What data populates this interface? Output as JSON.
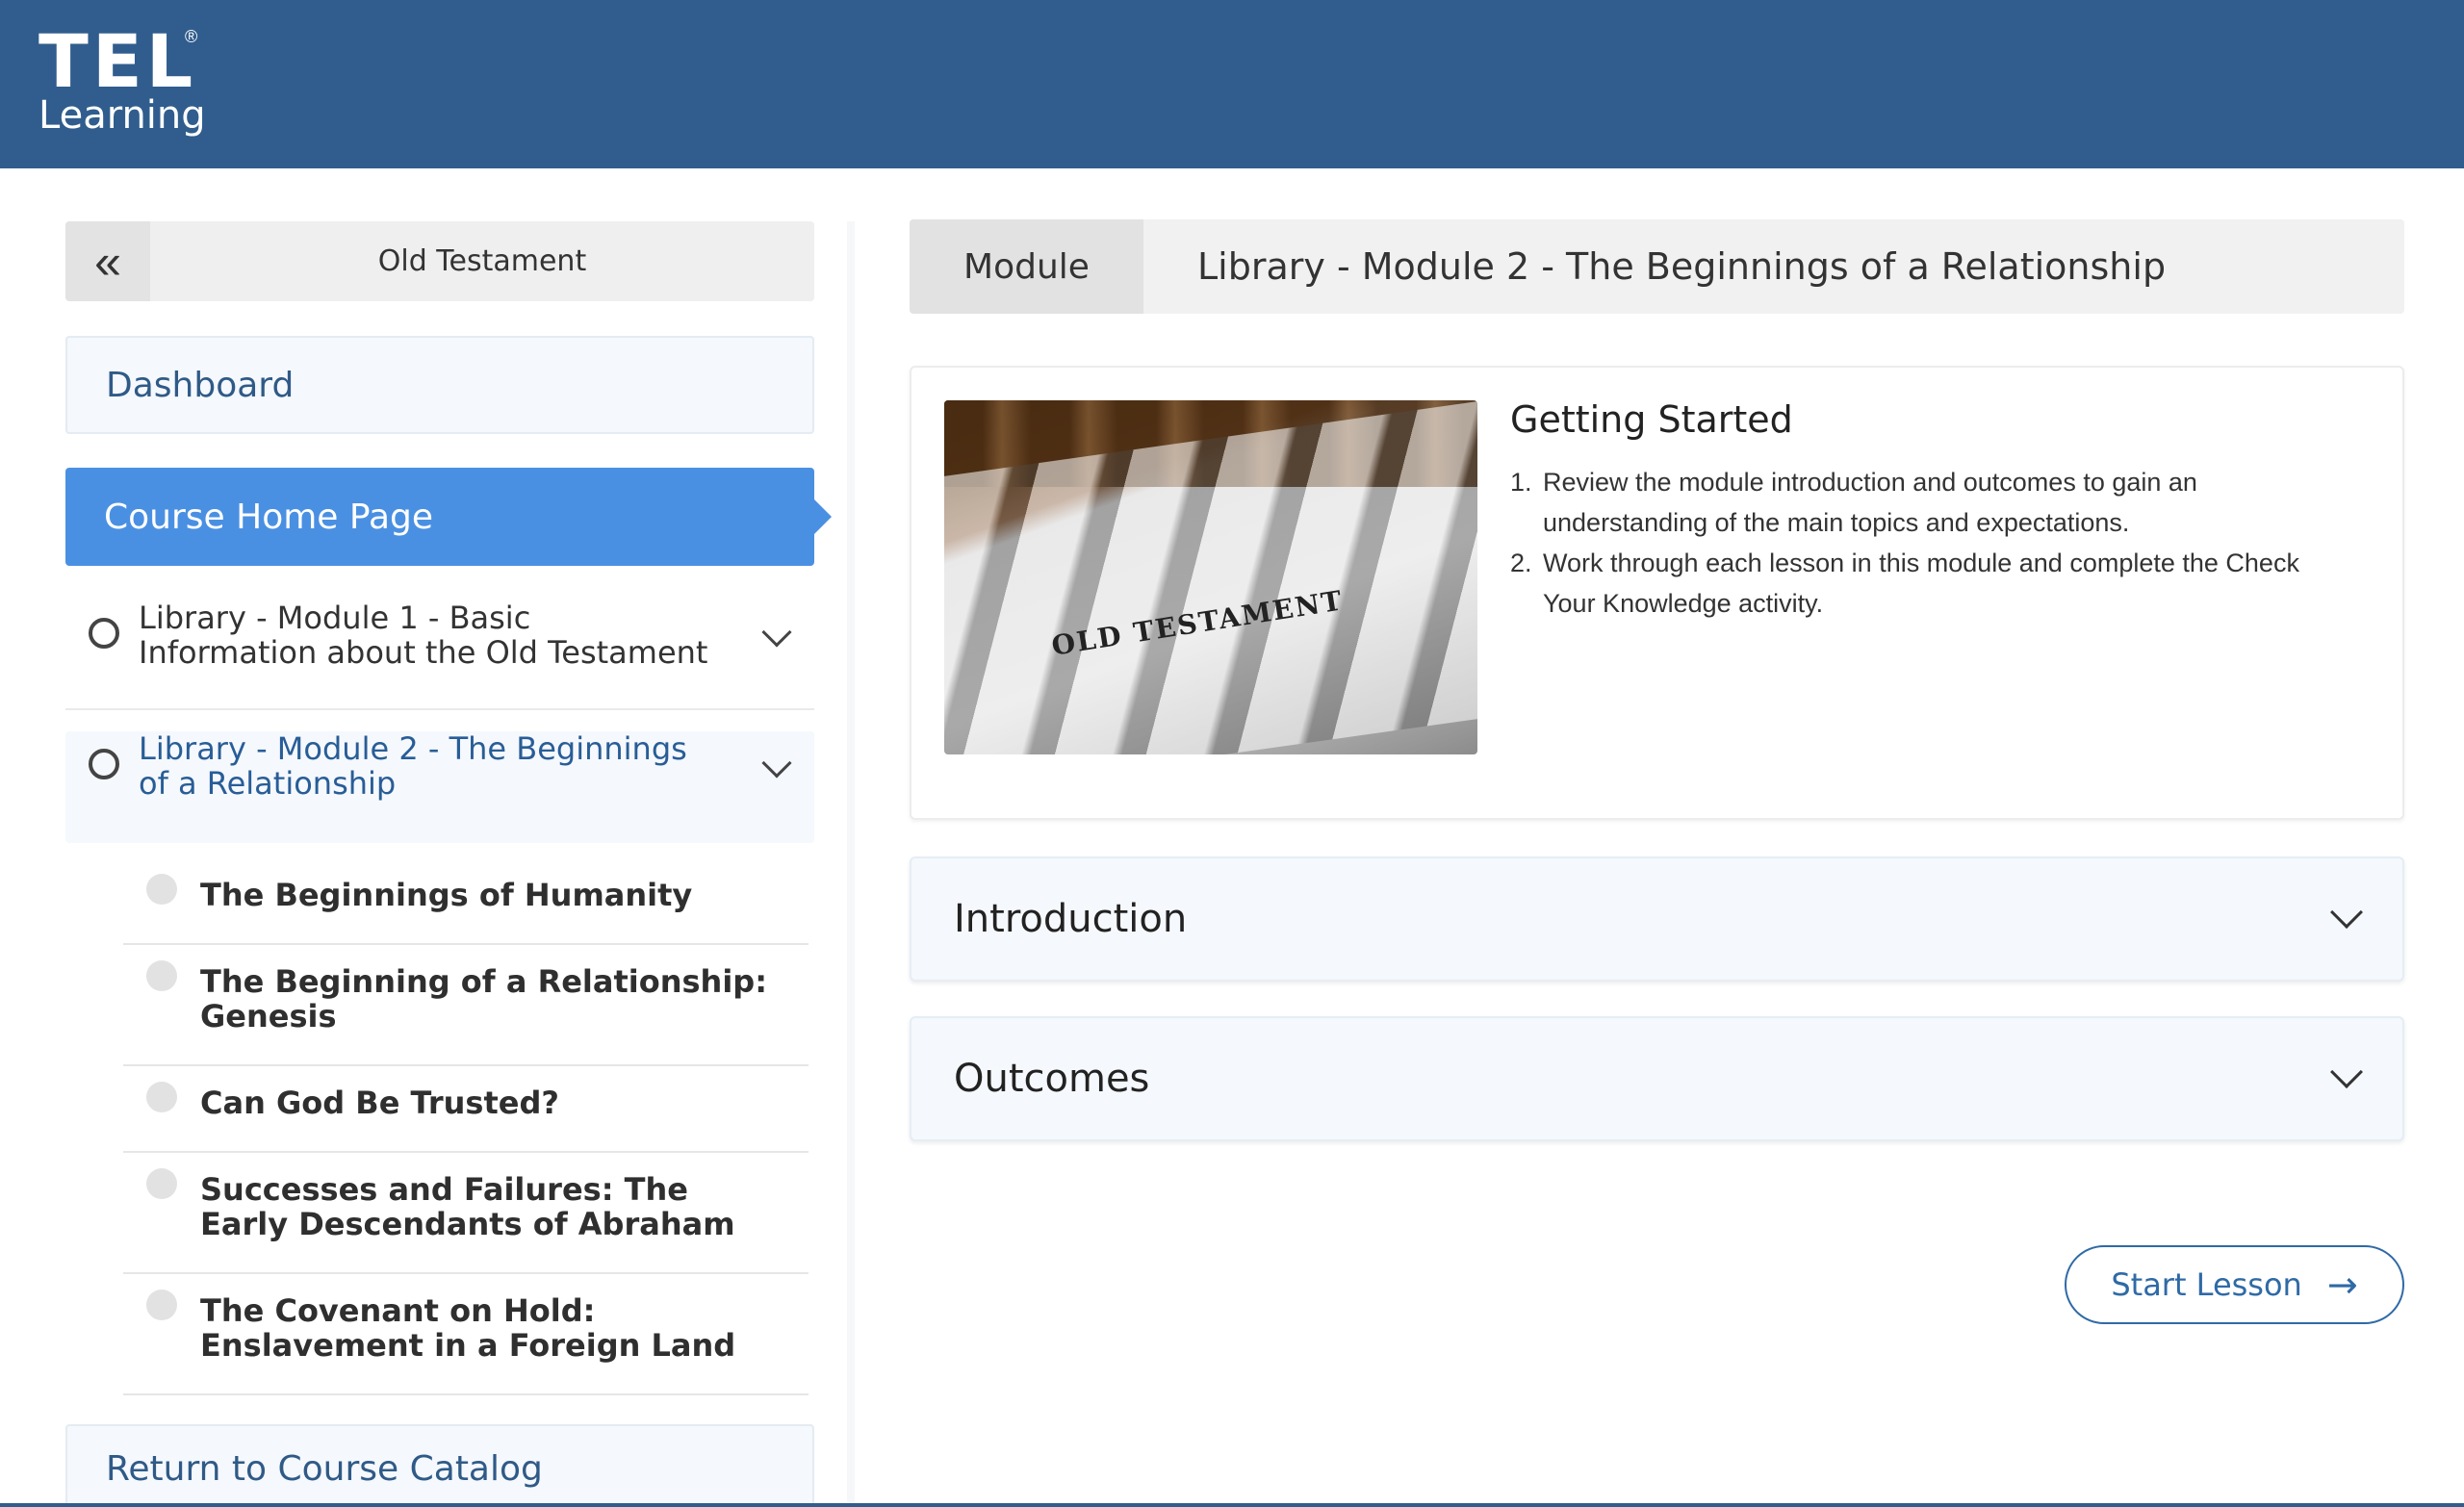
{
  "brand": {
    "name": "TEL",
    "registered": "®",
    "sub": "Learning",
    "color": "#305d8d"
  },
  "sidebar": {
    "collapse_icon": "double-chevron-left-icon",
    "collapse_glyph": "«",
    "course_title": "Old Testament",
    "dashboard_label": "Dashboard",
    "course_home_label": "Course Home Page",
    "modules": [
      {
        "label": "Library - Module 1 - Basic Information about the Old Testament",
        "expanded": false
      },
      {
        "label": "Library - Module 2 - The Beginnings of a Relationship",
        "expanded": true,
        "lessons": [
          "The Beginnings of Humanity",
          "The Beginning of a Relationship: Genesis",
          "Can God Be Trusted?",
          "Successes and Failures: The Early Descendants of Abraham",
          "The Covenant on Hold: Enslavement in a Foreign Land"
        ]
      }
    ],
    "return_label": "Return to Course Catalog"
  },
  "main": {
    "module_tag": "Module",
    "module_name": "Library - Module 2 - The Beginnings of a Relationship",
    "card": {
      "image_text": "OLD TESTAMENT",
      "title": "Getting Started",
      "steps": [
        "Review the module introduction and outcomes to gain an understanding of the main topics and expectations.",
        "Work through each lesson in this module and complete the Check Your Knowledge activity."
      ]
    },
    "accordions": [
      "Introduction",
      "Outcomes"
    ],
    "start_button": {
      "label": "Start Lesson",
      "icon": "arrow-right-icon",
      "glyph": "→"
    }
  },
  "colors": {
    "accent": "#4a90e2",
    "link": "#2f5a87",
    "button": "#2f6aa6"
  }
}
